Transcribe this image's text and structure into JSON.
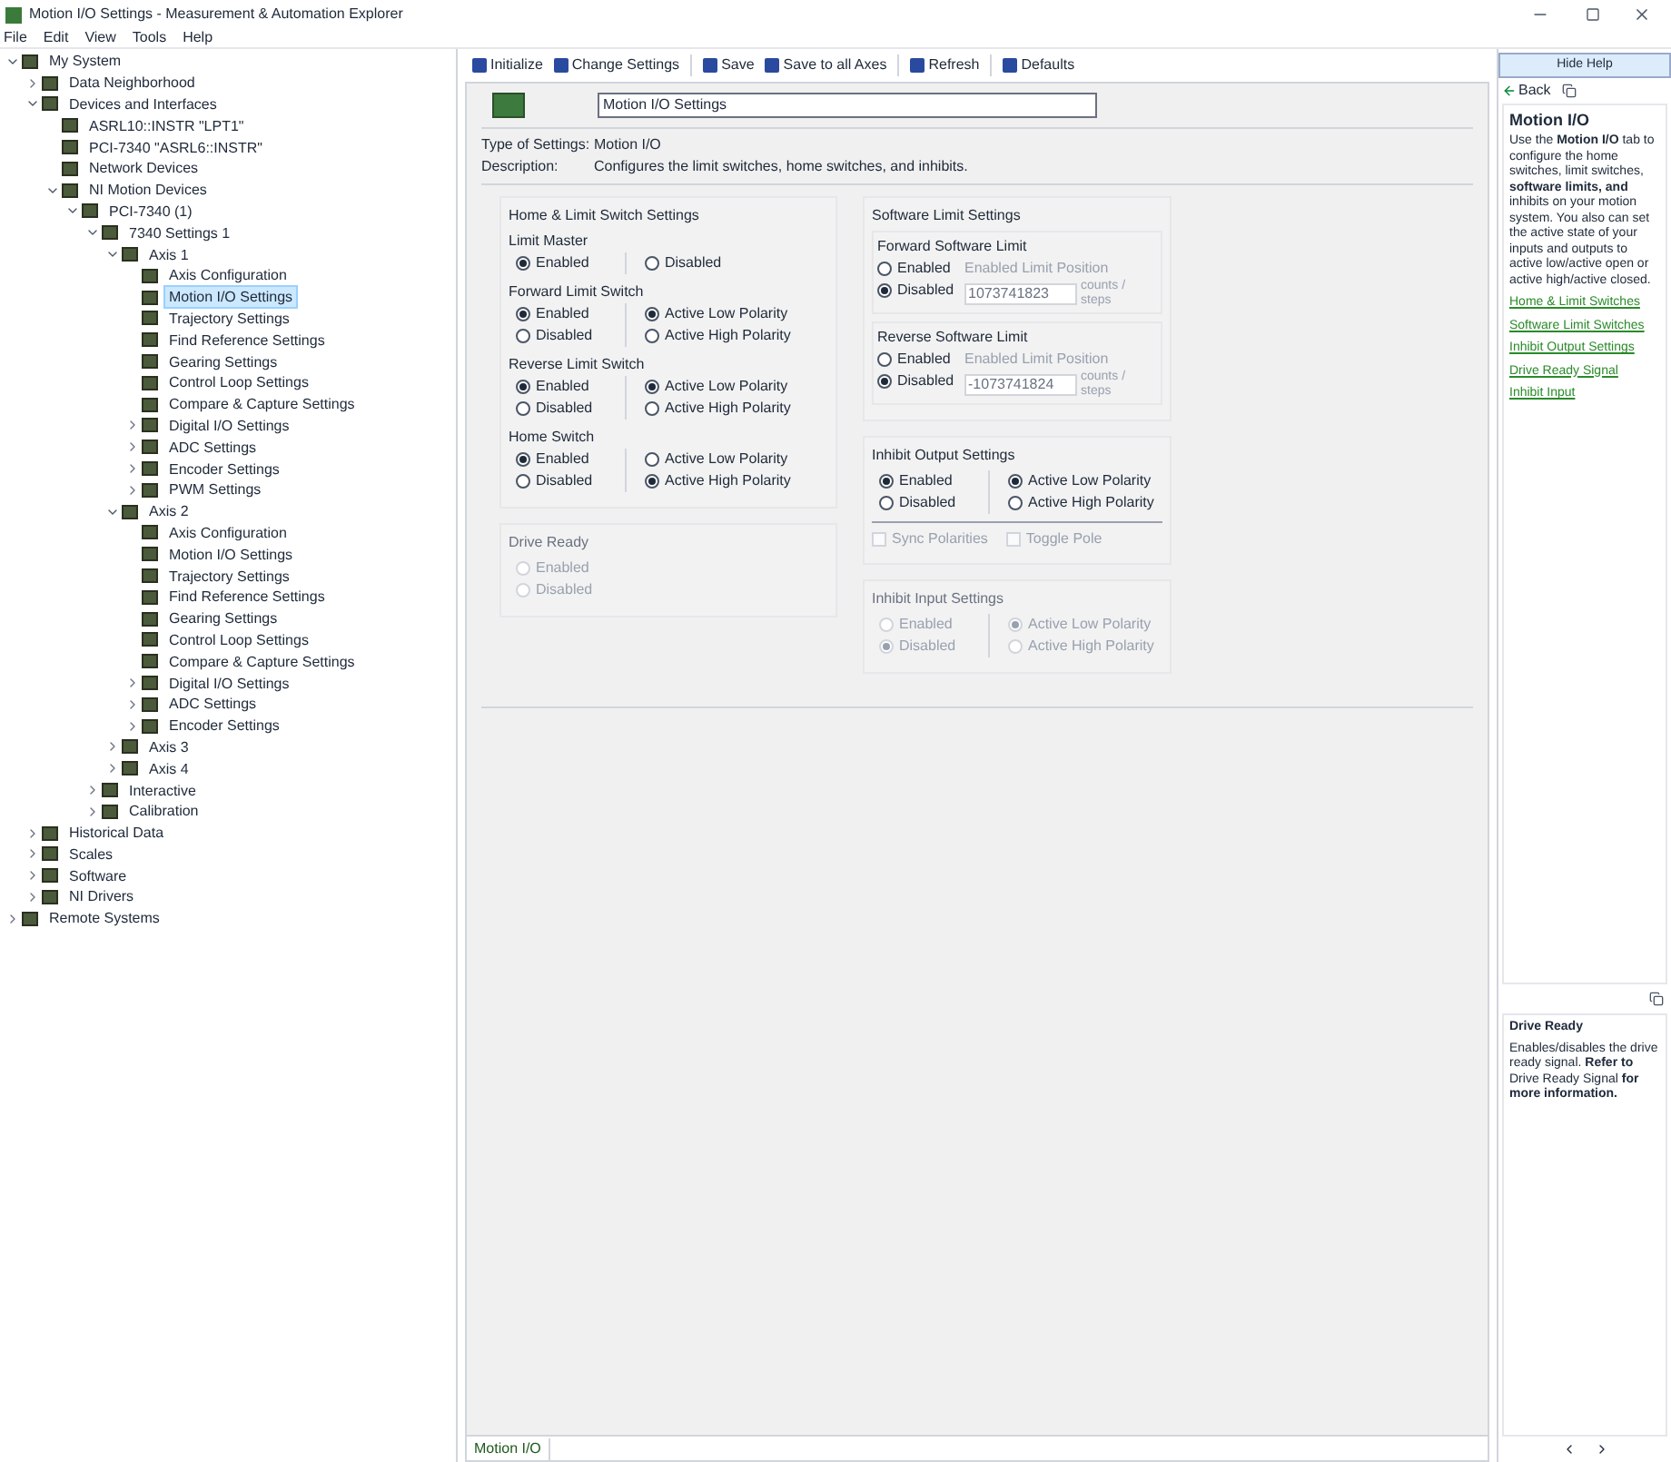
{
  "window": {
    "title": "Motion I/O Settings - Measurement & Automation Explorer"
  },
  "menu": [
    "File",
    "Edit",
    "View",
    "Tools",
    "Help"
  ],
  "tree": [
    {
      "label": "My System",
      "expanded": true,
      "selected": false,
      "children": [
        {
          "label": "Data Neighborhood",
          "expanded": false,
          "selected": false
        },
        {
          "label": "Devices and Interfaces",
          "expanded": true,
          "selected": false,
          "children": [
            {
              "label": "ASRL10::INSTR \"LPT1\"",
              "selected": false
            },
            {
              "label": "PCI-7340 \"ASRL6::INSTR\"",
              "selected": false
            },
            {
              "label": "Network Devices",
              "selected": false
            },
            {
              "label": "NI Motion Devices",
              "expanded": true,
              "selected": false,
              "children": [
                {
                  "label": "PCI-7340 (1)",
                  "expanded": true,
                  "selected": false,
                  "children": [
                    {
                      "label": "7340 Settings 1",
                      "expanded": true,
                      "selected": false,
                      "children": [
                        {
                          "label": "Axis 1",
                          "expanded": true,
                          "selected": false,
                          "children": [
                            {
                              "label": "Axis Configuration",
                              "selected": false
                            },
                            {
                              "label": "Motion I/O Settings",
                              "selected": true
                            },
                            {
                              "label": "Trajectory Settings",
                              "selected": false
                            },
                            {
                              "label": "Find Reference Settings",
                              "selected": false
                            },
                            {
                              "label": "Gearing Settings",
                              "selected": false
                            },
                            {
                              "label": "Control Loop Settings",
                              "selected": false
                            },
                            {
                              "label": "Compare & Capture Settings",
                              "selected": false
                            },
                            {
                              "label": "Digital I/O Settings",
                              "expanded": false,
                              "selected": false
                            },
                            {
                              "label": "ADC Settings",
                              "expanded": false,
                              "selected": false
                            },
                            {
                              "label": "Encoder Settings",
                              "expanded": false,
                              "selected": false
                            },
                            {
                              "label": "PWM Settings",
                              "expanded": false,
                              "selected": false
                            }
                          ]
                        },
                        {
                          "label": "Axis 2",
                          "expanded": true,
                          "selected": false,
                          "children": [
                            {
                              "label": "Axis Configuration",
                              "selected": false
                            },
                            {
                              "label": "Motion I/O Settings",
                              "selected": false
                            },
                            {
                              "label": "Trajectory Settings",
                              "selected": false
                            },
                            {
                              "label": "Find Reference Settings",
                              "selected": false
                            },
                            {
                              "label": "Gearing Settings",
                              "selected": false
                            },
                            {
                              "label": "Control Loop Settings",
                              "selected": false
                            },
                            {
                              "label": "Compare & Capture Settings",
                              "selected": false
                            },
                            {
                              "label": "Digital I/O Settings",
                              "expanded": false,
                              "selected": false
                            },
                            {
                              "label": "ADC Settings",
                              "expanded": false,
                              "selected": false
                            },
                            {
                              "label": "Encoder Settings",
                              "expanded": false,
                              "selected": false
                            }
                          ]
                        },
                        {
                          "label": "Axis 3",
                          "expanded": false,
                          "selected": false
                        },
                        {
                          "label": "Axis 4",
                          "expanded": false,
                          "selected": false
                        }
                      ]
                    },
                    {
                      "label": "Interactive",
                      "expanded": false,
                      "selected": false
                    },
                    {
                      "label": "Calibration",
                      "expanded": false,
                      "selected": false
                    }
                  ]
                }
              ]
            }
          ]
        },
        {
          "label": "Historical Data",
          "expanded": false,
          "selected": false
        },
        {
          "label": "Scales",
          "expanded": false,
          "selected": false
        },
        {
          "label": "Software",
          "expanded": false,
          "selected": false
        },
        {
          "label": "NI Drivers",
          "expanded": false,
          "selected": false
        }
      ]
    },
    {
      "label": "Remote Systems",
      "expanded": false,
      "selected": false
    }
  ],
  "toolbar": [
    {
      "label": "Initialize",
      "separator_after": false
    },
    {
      "label": "Change Settings",
      "separator_after": true
    },
    {
      "label": "Save",
      "separator_after": false
    },
    {
      "label": "Save to all Axes",
      "separator_after": true
    },
    {
      "label": "Refresh",
      "separator_after": true
    },
    {
      "label": "Defaults",
      "separator_after": false
    }
  ],
  "hide_help": "Hide Help",
  "header": {
    "name": "Motion I/O Settings",
    "type_label": "Type of Settings:",
    "type_value": "Motion I/O",
    "description_label": "Description:",
    "description_value": "Configures the limit switches, home switches, and inhibits."
  },
  "left_groups": [
    {
      "title": "Home & Limit Switch Settings",
      "disabled": false,
      "sections": [
        {
          "kind": "radios",
          "title": "Limit Master",
          "columns": [
            [
              {
                "label": "Enabled",
                "selected": true
              }
            ],
            [
              {
                "label": "Disabled",
                "selected": false
              }
            ]
          ]
        },
        {
          "kind": "radios",
          "title": "Forward Limit Switch",
          "columns": [
            [
              {
                "label": "Enabled",
                "selected": true
              },
              {
                "label": "Disabled",
                "selected": false
              }
            ],
            [
              {
                "label": "Active Low Polarity",
                "selected": true
              },
              {
                "label": "Active High Polarity",
                "selected": false
              }
            ]
          ]
        },
        {
          "kind": "radios",
          "title": "Reverse Limit Switch",
          "columns": [
            [
              {
                "label": "Enabled",
                "selected": true
              },
              {
                "label": "Disabled",
                "selected": false
              }
            ],
            [
              {
                "label": "Active Low Polarity",
                "selected": true
              },
              {
                "label": "Active High Polarity",
                "selected": false
              }
            ]
          ]
        },
        {
          "kind": "radios",
          "title": "Home Switch",
          "columns": [
            [
              {
                "label": "Enabled",
                "selected": true
              },
              {
                "label": "Disabled",
                "selected": false
              }
            ],
            [
              {
                "label": "Active Low Polarity",
                "selected": false
              },
              {
                "label": "Active High Polarity",
                "selected": true
              }
            ]
          ]
        }
      ]
    },
    {
      "title": "Drive Ready",
      "disabled": true,
      "sections": [
        {
          "kind": "radios",
          "columns": [
            [
              {
                "label": "Enabled",
                "selected": false
              },
              {
                "label": "Disabled",
                "selected": false
              }
            ]
          ]
        }
      ]
    }
  ],
  "right_groups": [
    {
      "title": "Software Limit Settings",
      "disabled": false,
      "sections": [
        {
          "kind": "limit",
          "title": "Forward Software Limit",
          "radios": [
            {
              "label": "Enabled",
              "selected": false
            },
            {
              "label": "Disabled",
              "selected": true
            }
          ],
          "hint": "Enabled Limit Position",
          "value": "1073741823",
          "unit": "counts / steps"
        },
        {
          "kind": "limit",
          "title": "Reverse Software Limit",
          "radios": [
            {
              "label": "Enabled",
              "selected": false
            },
            {
              "label": "Disabled",
              "selected": true
            }
          ],
          "hint": "Enabled Limit Position",
          "value": "-1073741824",
          "unit": "counts / steps"
        }
      ]
    },
    {
      "title": "Inhibit Output Settings",
      "disabled": false,
      "sections": [
        {
          "kind": "radios",
          "columns": [
            [
              {
                "label": "Enabled",
                "selected": true
              },
              {
                "label": "Disabled",
                "selected": false
              }
            ],
            [
              {
                "label": "Active Low Polarity",
                "selected": true
              },
              {
                "label": "Active High Polarity",
                "selected": false
              }
            ]
          ]
        },
        {
          "kind": "checks",
          "disabled": true,
          "items": [
            {
              "label": "Sync Polarities",
              "checked": false
            },
            {
              "label": "Toggle Pole",
              "checked": false
            }
          ]
        }
      ]
    },
    {
      "title": "Inhibit Input Settings",
      "disabled": true,
      "sections": [
        {
          "kind": "radios",
          "columns": [
            [
              {
                "label": "Enabled",
                "selected": false
              },
              {
                "label": "Disabled",
                "selected": true
              }
            ],
            [
              {
                "label": "Active Low Polarity",
                "selected": true
              },
              {
                "label": "Active High Polarity",
                "selected": false
              }
            ]
          ]
        }
      ]
    }
  ],
  "help": {
    "back": "Back",
    "title": "Motion I/O",
    "body": "Use the **Motion I/O** tab to configure the home switches, limit switches, **software limits, and** inhibits on your motion system. You also can set the active state of your inputs and outputs to active low/active open or active high/active closed.",
    "links": [
      "Home & Limit Switches",
      "Software Limit Switches",
      "Inhibit Output Settings",
      "Drive Ready Signal",
      "Inhibit Input"
    ],
    "lower_title": "Drive Ready",
    "lower_body": "Enables/disables the drive ready signal. **Refer to** Drive Ready Signal **for more information.**"
  },
  "bottom_tab": "Motion I/O"
}
